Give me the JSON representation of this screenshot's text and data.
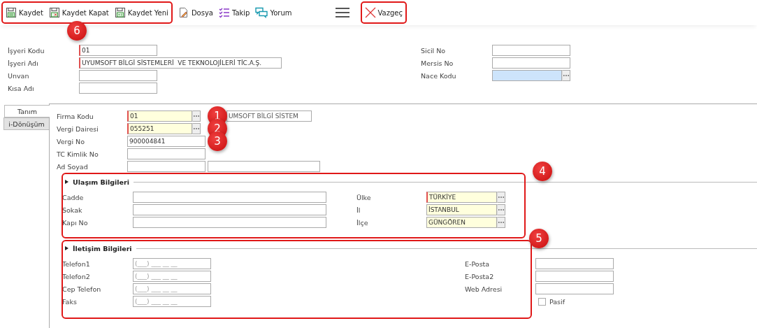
{
  "toolbar": {
    "groups": [
      {
        "framed": true,
        "callout": "6",
        "buttons": [
          {
            "kind": "save",
            "label": "Kaydet"
          },
          {
            "kind": "save-close",
            "label": "Kaydet Kapat"
          },
          {
            "kind": "save-new",
            "label": "Kaydet Yeni"
          }
        ]
      },
      {
        "framed": false,
        "buttons": [
          {
            "kind": "file",
            "label": "Dosya"
          },
          {
            "kind": "task",
            "label": "Takip"
          },
          {
            "kind": "comment",
            "label": "Yorum"
          }
        ]
      },
      {
        "framed": false,
        "buttons": [
          {
            "kind": "menu"
          }
        ]
      },
      {
        "framed": true,
        "buttons": [
          {
            "kind": "cancel",
            "label": "Vazgeç"
          }
        ]
      }
    ]
  },
  "header": {
    "left": [
      {
        "label": "İşyeri Kodu",
        "inputs": [
          {
            "kind": "text",
            "value": "01",
            "required": true
          }
        ]
      },
      {
        "label": "İşyeri Adı",
        "inputs": [
          {
            "kind": "long",
            "value": "UYUMSOFT BİLGİ SİSTEMLERİ  VE TEKNOLOJİLERİ TİC.A.Ş.",
            "required": true
          }
        ]
      },
      {
        "label": "Unvan",
        "inputs": [
          {
            "kind": "text",
            "required": false
          }
        ]
      },
      {
        "label": "Kısa Adı",
        "inputs": [
          {
            "kind": "text",
            "required": false
          }
        ]
      }
    ],
    "right": [
      {
        "label": "Sicil No",
        "inputs": [
          {
            "kind": "text",
            "required": false
          }
        ]
      },
      {
        "label": "Mersis No",
        "inputs": [
          {
            "kind": "text",
            "required": false
          }
        ]
      },
      {
        "label": "Nace Kodu",
        "inputs": [
          {
            "kind": "lookup",
            "required": false,
            "color": "#cde4fb"
          }
        ]
      }
    ]
  },
  "tabs": [
    {
      "label": "Tanım",
      "selected": true
    },
    {
      "label": "i-Dönüşüm",
      "selected": false
    }
  ],
  "firm": [
    {
      "label": "Firma Kodu",
      "callout": "1",
      "inputs": [
        {
          "kind": "lookup",
          "value": "01",
          "required": true,
          "color": "#ffffdd"
        },
        {
          "kind": "display",
          "value": "UMSOFT BİLGİ SİSTEM",
          "required": false
        }
      ]
    },
    {
      "label": "Vergi Dairesi",
      "callout": "2",
      "inputs": [
        {
          "kind": "lookup",
          "value": "055251",
          "required": true,
          "color": "#ffffdd"
        }
      ]
    },
    {
      "label": "Vergi No",
      "callout": "3",
      "inputs": [
        {
          "kind": "text",
          "value": "900004841",
          "required": false
        }
      ]
    },
    {
      "label": "TC Kimlik No",
      "inputs": [
        {
          "kind": "text",
          "required": false
        }
      ]
    },
    {
      "label": "Ad Soyad",
      "inputs": [
        {
          "kind": "text",
          "required": false
        },
        {
          "kind": "long",
          "required": false
        }
      ]
    }
  ],
  "sections": [
    {
      "kind": "address",
      "title": "Ulaşım Bilgileri",
      "callout": "4",
      "left": [
        {
          "kind": "field",
          "label": "Cadde",
          "inputs": [
            {
              "kind": "long",
              "required": false
            }
          ]
        },
        {
          "kind": "field",
          "label": "Sokak",
          "inputs": [
            {
              "kind": "long",
              "required": false
            }
          ]
        },
        {
          "kind": "field",
          "label": "Kapı No",
          "inputs": [
            {
              "kind": "long",
              "required": false
            }
          ]
        }
      ],
      "right": [
        {
          "kind": "field",
          "label": "Ülke",
          "inputs": [
            {
              "kind": "lookup",
              "value": "TÜRKİYE",
              "required": true,
              "color": "#ffffdd"
            }
          ]
        },
        {
          "kind": "field",
          "label": "İl",
          "inputs": [
            {
              "kind": "lookup",
              "value": "İSTANBUL",
              "required": false,
              "color": "#ffffdd"
            }
          ]
        },
        {
          "kind": "field",
          "label": "İlçe",
          "inputs": [
            {
              "kind": "lookup",
              "value": "GÜNGÖREN",
              "required": false,
              "color": "#ffffdd"
            }
          ]
        }
      ]
    },
    {
      "kind": "contact",
      "title": "İletişim Bilgileri",
      "callout": "5",
      "left": [
        {
          "kind": "field",
          "label": "Telefon1",
          "inputs": [
            {
              "kind": "text",
              "placeholder": "(___) ___ __ __",
              "required": false
            }
          ]
        },
        {
          "kind": "field",
          "label": "Telefon2",
          "inputs": [
            {
              "kind": "text",
              "placeholder": "(___) ___ __ __",
              "required": false
            }
          ]
        },
        {
          "kind": "field",
          "label": "Cep Telefon",
          "inputs": [
            {
              "kind": "text",
              "placeholder": "(___) ___ __ __",
              "required": false
            }
          ]
        },
        {
          "kind": "field",
          "label": "Faks",
          "inputs": [
            {
              "kind": "text",
              "placeholder": "(___) ___ __ __",
              "required": false
            }
          ]
        }
      ],
      "right": [
        {
          "kind": "field",
          "label": "E-Posta",
          "inputs": [
            {
              "kind": "text",
              "required": false
            }
          ]
        },
        {
          "kind": "field",
          "label": "E-Posta2",
          "inputs": [
            {
              "kind": "text",
              "required": false
            }
          ]
        },
        {
          "kind": "field",
          "label": "Web Adresi",
          "inputs": [
            {
              "kind": "text",
              "required": false
            }
          ]
        },
        {
          "kind": "checkbox",
          "label": "Pasif",
          "checked": false
        }
      ]
    }
  ]
}
